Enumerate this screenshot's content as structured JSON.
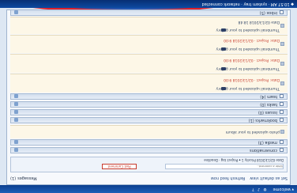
{
  "header": {
    "user_text": "▾ welcome",
    "icons": [
      "gear-icon",
      "bell-icon",
      "help-icon"
    ]
  },
  "groups": {
    "g1": "inbox (1)",
    "g2": "inbox (5)",
    "g3": "team (4)",
    "g4": "tasks (0)",
    "g5": "issues (0)",
    "g6": "bookmarks (1)",
    "g7": "media (3)",
    "g8": "conversations"
  },
  "items": {
    "i1_title": "Date 02/13/2018 18:48",
    "i1_text": "Thumbnail uploaded to your gallery",
    "i2_meta": "Date: Project · 02/13/2018 9:00",
    "i2_text": "Thumbnail uploaded to your gallery",
    "i3_meta": "Date: Project · 02/13/2018 9:00",
    "i3_text": "Thumbnail uploaded to your gallery",
    "i4_meta": "Date: Project · 02/13/2018 9:00",
    "i4_text": "Thumbnail uploaded to your gallery",
    "m1_text": "photo uploaded to your album"
  },
  "compose": {
    "placeholder": "Write a comment...",
    "row_text": "Date 02/13/2018 Priority 1 ▾ Project tag · Deadline",
    "post_label": "Post Comment"
  },
  "footer": {
    "left_text": "Messages",
    "left_sub": "(1)",
    "right_text": "Set as default view",
    "right_sub": "Refresh feed now"
  },
  "taskbar": {
    "text": "◆ 10:57 AM · system tray · network connected",
    "accent": "#e0202a"
  }
}
